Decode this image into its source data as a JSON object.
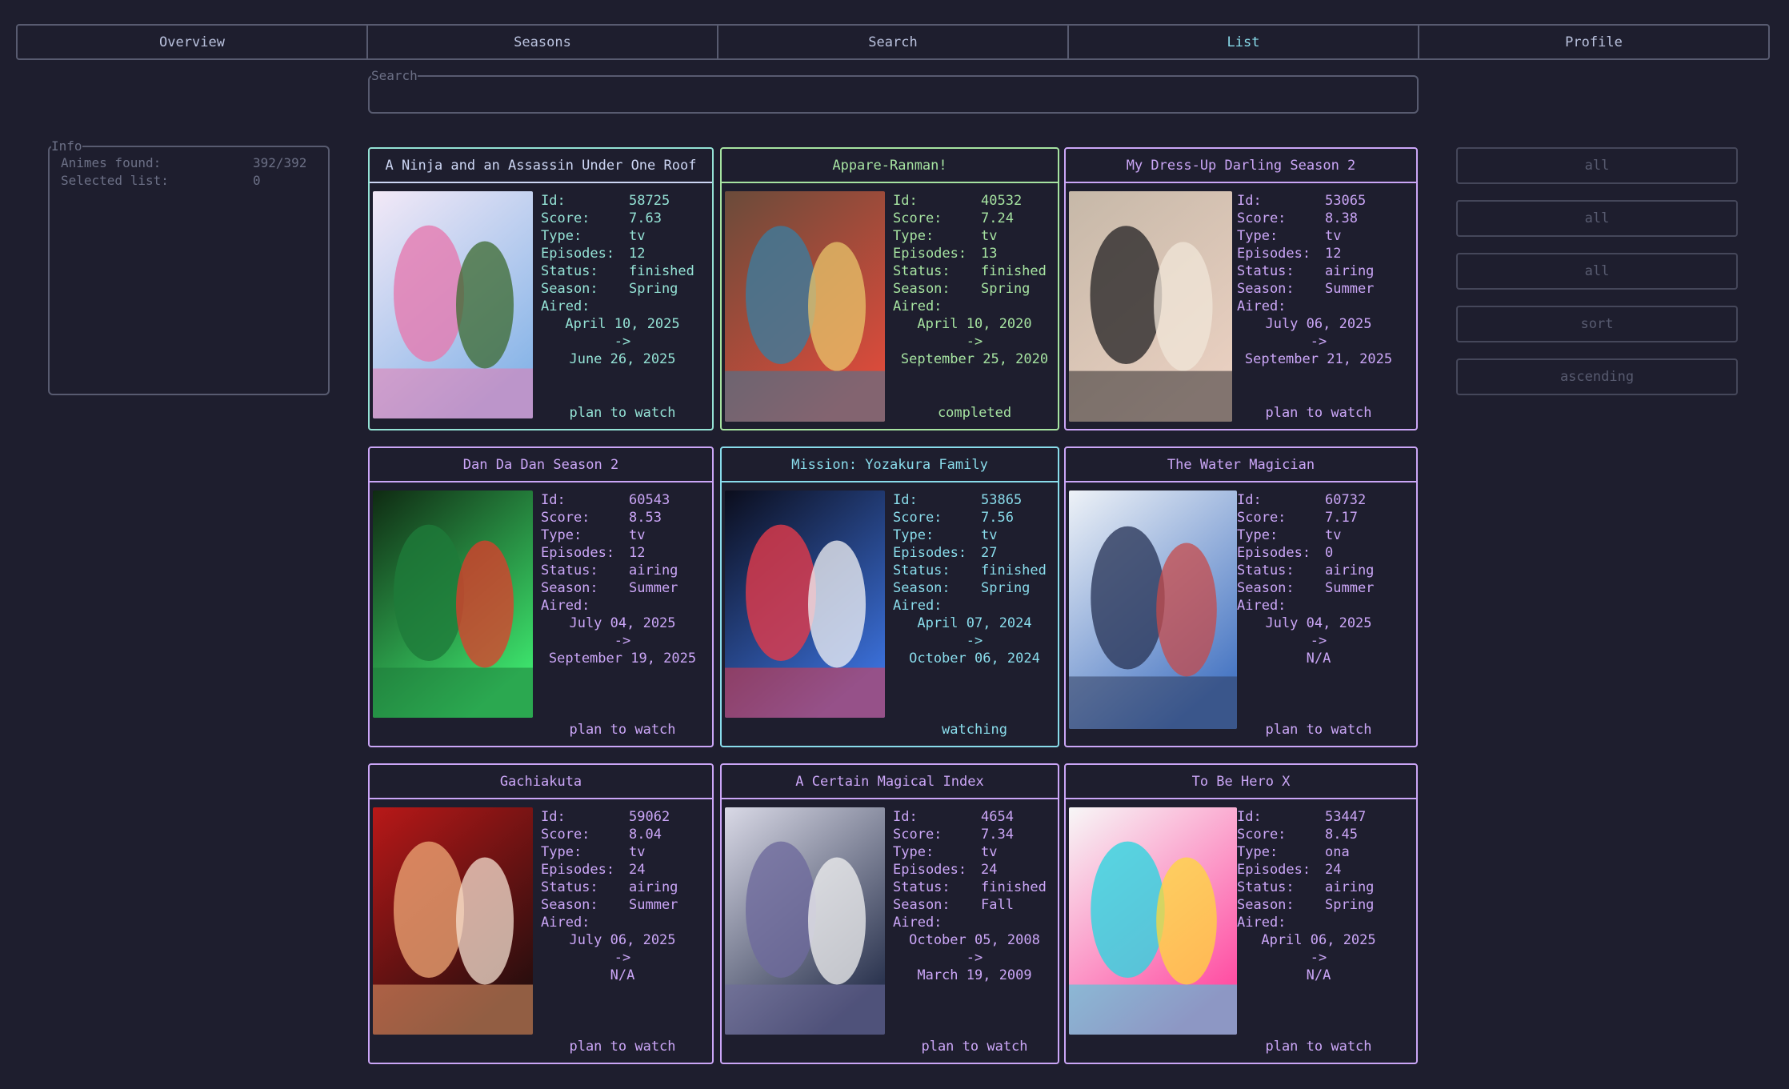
{
  "tabs": [
    "Overview",
    "Seasons",
    "Search",
    "List",
    "Profile"
  ],
  "active_tab": "List",
  "search": {
    "legend": "Search",
    "value": ""
  },
  "info": {
    "legend": "Info",
    "animes_found_label": "Animes found:",
    "animes_found_value": "392/392",
    "selected_list_label": "Selected list:",
    "selected_list_value": "0"
  },
  "side_buttons": [
    "all",
    "all",
    "all",
    "sort",
    "ascending"
  ],
  "field_labels": {
    "id": "Id:",
    "score": "Score:",
    "type": "Type:",
    "episodes": "Episodes:",
    "status": "Status:",
    "season": "Season:",
    "aired": "Aired:",
    "arrow": "->"
  },
  "cards": [
    {
      "title": "A Ninja and an Assassin Under One Roof",
      "id": "58725",
      "score": "7.63",
      "type": "tv",
      "episodes": "12",
      "status": "finished",
      "season": "Spring",
      "aired_from": "April 10, 2025",
      "aired_to": "June 26, 2025",
      "list_status": "plan to watch",
      "accent": "#94e2d5",
      "poster_icon": "anime-poster-image"
    },
    {
      "title": "Appare-Ranman!",
      "id": "40532",
      "score": "7.24",
      "type": "tv",
      "episodes": "13",
      "status": "finished",
      "season": "Spring",
      "aired_from": "April 10, 2020",
      "aired_to": "September 25, 2020",
      "list_status": "completed",
      "accent": "#a6e3a1",
      "poster_icon": "anime-poster-image"
    },
    {
      "title": "My Dress-Up Darling Season 2",
      "id": "53065",
      "score": "8.38",
      "type": "tv",
      "episodes": "12",
      "status": "airing",
      "season": "Summer",
      "aired_from": "July 06, 2025",
      "aired_to": "September 21, 2025",
      "list_status": "plan to watch",
      "accent": "#cba6f7",
      "poster_icon": "anime-poster-image"
    },
    {
      "title": "Dan Da Dan Season 2",
      "id": "60543",
      "score": "8.53",
      "type": "tv",
      "episodes": "12",
      "status": "airing",
      "season": "Summer",
      "aired_from": "July 04, 2025",
      "aired_to": "September 19, 2025",
      "list_status": "plan to watch",
      "accent": "#cba6f7",
      "poster_icon": "anime-poster-image"
    },
    {
      "title": "Mission: Yozakura Family",
      "id": "53865",
      "score": "7.56",
      "type": "tv",
      "episodes": "27",
      "status": "finished",
      "season": "Spring",
      "aired_from": "April 07, 2024",
      "aired_to": "October 06, 2024",
      "list_status": "watching",
      "accent": "#89dceb",
      "poster_icon": "anime-poster-image"
    },
    {
      "title": "The Water Magician",
      "id": "60732",
      "score": "7.17",
      "type": "tv",
      "episodes": "0",
      "status": "airing",
      "season": "Summer",
      "aired_from": "July 04, 2025",
      "aired_to": "N/A",
      "list_status": "plan to watch",
      "accent": "#cba6f7",
      "poster_icon": "anime-poster-image"
    },
    {
      "title": "Gachiakuta",
      "id": "59062",
      "score": "8.04",
      "type": "tv",
      "episodes": "24",
      "status": "airing",
      "season": "Summer",
      "aired_from": "July 06, 2025",
      "aired_to": "N/A",
      "list_status": "plan to watch",
      "accent": "#cba6f7",
      "poster_icon": "anime-poster-image"
    },
    {
      "title": "A Certain Magical Index",
      "id": "4654",
      "score": "7.34",
      "type": "tv",
      "episodes": "24",
      "status": "finished",
      "season": "Fall",
      "aired_from": "October 05, 2008",
      "aired_to": "March 19, 2009",
      "list_status": "plan to watch",
      "accent": "#cba6f7",
      "poster_icon": "anime-poster-image"
    },
    {
      "title": "To Be Hero X",
      "id": "53447",
      "score": "8.45",
      "type": "ona",
      "episodes": "24",
      "status": "airing",
      "season": "Spring",
      "aired_from": "April 06, 2025",
      "aired_to": "N/A",
      "list_status": "plan to watch",
      "accent": "#cba6f7",
      "poster_icon": "anime-poster-image"
    }
  ]
}
